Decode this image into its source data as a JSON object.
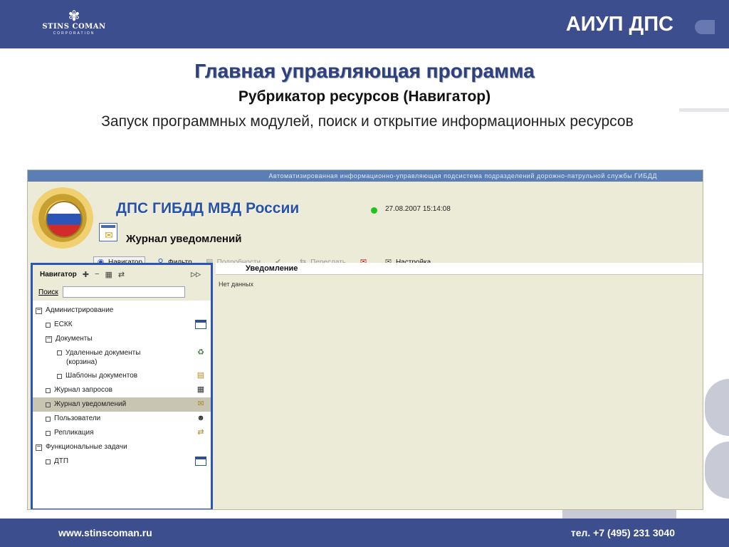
{
  "slide": {
    "logo_mark": "✾",
    "logo_name": "STINS COMAN",
    "logo_sub": "CORPORATION",
    "brand_title": "АИУП ДПС",
    "title": "Главная управляющая программа",
    "subtitle": "Рубрикатор ресурсов (Навигатор)",
    "description": "Запуск программных модулей, поиск и открытие информационных ресурсов",
    "footer_site": "www.stinscoman.ru",
    "footer_phone": "тел. +7 (495) 231 3040"
  },
  "app": {
    "titlebar": "Автоматизированная информационно-управляющая подсистема подразделений дорожно-патрульной службы ГИБДД",
    "name": "ДПС ГИБДД МВД России",
    "datetime": "27.08.2007 15:14:08",
    "module_title": "Журнал уведомлений",
    "toolbar": [
      {
        "label": "Навигатор",
        "icon": "navigator-icon",
        "glyph": "◉"
      },
      {
        "label": "Фильтр",
        "icon": "filter-icon",
        "glyph": "⚲"
      },
      {
        "label": "Подробности",
        "icon": "details-icon",
        "glyph": "▤"
      },
      {
        "label": "",
        "icon": "check-icon",
        "glyph": "✔"
      },
      {
        "label": "Переслать",
        "icon": "forward-icon",
        "glyph": "⇆"
      },
      {
        "label": "",
        "icon": "delete-mail-icon",
        "glyph": "✉"
      },
      {
        "label": "Настройка",
        "icon": "settings-icon",
        "glyph": "✉"
      }
    ],
    "navigator": {
      "title": "Навигатор",
      "tools": [
        "✚",
        "−",
        "▦",
        "⇄"
      ],
      "collapse": "▷▷",
      "search_label": "Поиск",
      "search_value": "",
      "items": [
        {
          "label": "Администрирование",
          "sub": "",
          "icon": ""
        },
        {
          "label": "ЕСКК",
          "sub": "",
          "icon": "window-icon"
        },
        {
          "label": "Документы",
          "sub": "",
          "icon": ""
        },
        {
          "label": "Удаленные документы",
          "sub": "(корзина)",
          "icon": "recycle-icon"
        },
        {
          "label": "Шаблоны документов",
          "sub": "",
          "icon": "template-icon"
        },
        {
          "label": "Журнал запросов",
          "sub": "",
          "icon": "requests-icon"
        },
        {
          "label": "Журнал уведомлений",
          "sub": "",
          "icon": "notifications-icon"
        },
        {
          "label": "Пользователи",
          "sub": "",
          "icon": "users-icon"
        },
        {
          "label": "Репликация",
          "sub": "",
          "icon": "replication-icon"
        },
        {
          "label": "Функциональные задачи",
          "sub": "",
          "icon": ""
        },
        {
          "label": "ДТП",
          "sub": "",
          "icon": "window-icon"
        }
      ]
    },
    "content": {
      "column_header": "Уведомление",
      "empty_text": "Нет данных"
    }
  },
  "colors": {
    "band": "#3d4e8e",
    "title": "#2f3f80",
    "app_accent": "#2b56b8",
    "app_bg": "#ecebd8"
  }
}
